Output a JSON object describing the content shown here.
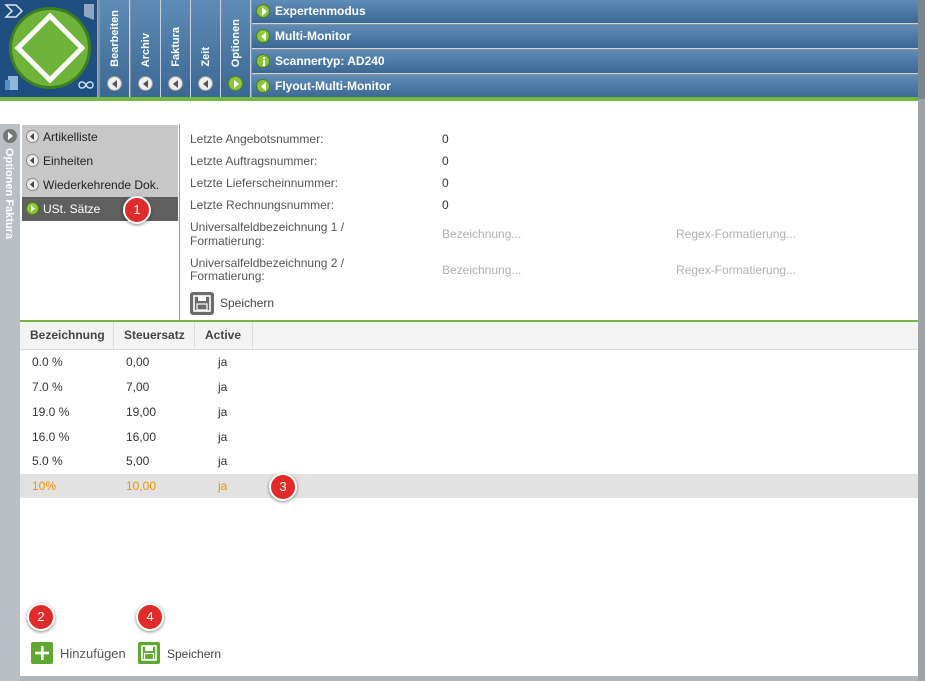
{
  "topbar": {
    "tabs": [
      {
        "label": "Bearbeiten"
      },
      {
        "label": "Archiv"
      },
      {
        "label": "Faktura"
      },
      {
        "label": "Zeit"
      },
      {
        "label": "Optionen"
      }
    ],
    "menu": [
      {
        "label": "Expertenmodus"
      },
      {
        "label": "Multi-Monitor"
      },
      {
        "label": "Scannertyp: AD240"
      },
      {
        "label": "Flyout-Multi-Monitor"
      }
    ]
  },
  "sidestrip": {
    "label": "Optionen  Faktura"
  },
  "settings_list": {
    "items": [
      {
        "label": "Artikelliste"
      },
      {
        "label": "Einheiten"
      },
      {
        "label": "Wiederkehrende Dok."
      },
      {
        "label": "USt. Sätze"
      }
    ]
  },
  "form": {
    "fields": [
      {
        "label": "Letzte Angebotsnummer:",
        "value": "0"
      },
      {
        "label": "Letzte Auftragsnummer:",
        "value": "0"
      },
      {
        "label": "Letzte Lieferscheinnummer:",
        "value": "0"
      },
      {
        "label": "Letzte Rechnungsnummer:",
        "value": "0"
      }
    ],
    "universal": [
      {
        "label_line1": "Universalfeldbezeichnung 1 /",
        "label_line2": "Formatierung:",
        "name_placeholder": "Bezeichnung...",
        "regex_placeholder": "Regex-Formatierung..."
      },
      {
        "label_line1": "Universalfeldbezeichnung 2 /",
        "label_line2": "Formatierung:",
        "name_placeholder": "Bezeichnung...",
        "regex_placeholder": "Regex-Formatierung..."
      }
    ],
    "save_label": "Speichern"
  },
  "table": {
    "columns": [
      "Bezeichnung",
      "Steuersatz",
      "Active"
    ],
    "rows": [
      {
        "bezeichnung": "0.0 %",
        "steuersatz": "0,00",
        "active": "ja"
      },
      {
        "bezeichnung": "7.0 %",
        "steuersatz": "7,00",
        "active": "ja"
      },
      {
        "bezeichnung": "19.0 %",
        "steuersatz": "19,00",
        "active": "ja"
      },
      {
        "bezeichnung": "16.0 %",
        "steuersatz": "16,00",
        "active": "ja"
      },
      {
        "bezeichnung": "5.0 %",
        "steuersatz": "5,00",
        "active": "ja"
      },
      {
        "bezeichnung": "10%",
        "steuersatz": "10,00",
        "active": "ja"
      }
    ],
    "selected_row_index": 5
  },
  "bottom": {
    "add_label": "Hinzufügen",
    "save_label": "Speichern"
  },
  "badges": {
    "b1": "1",
    "b2": "2",
    "b3": "3",
    "b4": "4"
  },
  "colors": {
    "accent_green": "#74b842",
    "menu_blue": "#4a78a4",
    "selected_text": "#f39200",
    "badge_red": "#e12a2a"
  }
}
